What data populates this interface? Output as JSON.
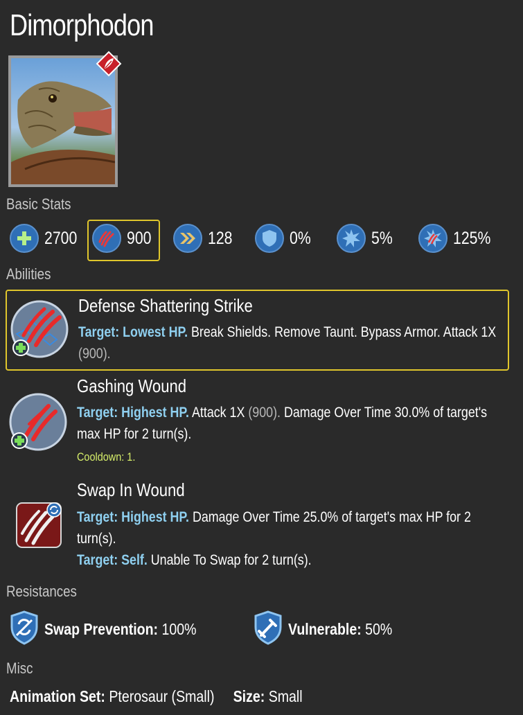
{
  "creature": {
    "name": "Dimorphodon",
    "rarity_icon": "rare-leaf-badge-icon",
    "portrait_icon": "dimorphodon-portrait"
  },
  "sections": {
    "basic_stats": "Basic Stats",
    "abilities": "Abilities",
    "resistances": "Resistances",
    "misc": "Misc"
  },
  "stats": [
    {
      "icon": "health-plus-icon",
      "value": "2700"
    },
    {
      "icon": "claw-damage-icon",
      "value": "900"
    },
    {
      "icon": "speed-chevron-icon",
      "value": "128"
    },
    {
      "icon": "armor-shield-icon",
      "value": "0%"
    },
    {
      "icon": "crit-chance-icon",
      "value": "5%"
    },
    {
      "icon": "crit-damage-icon",
      "value": "125%"
    }
  ],
  "abilities": [
    {
      "name": "Defense Shattering Strike",
      "icon": "shattering-claw-icon",
      "target_label": "Target: Lowest HP.",
      "effect": "Break Shields. Remove Taunt. Bypass Armor. Attack 1X",
      "damage": "(900).",
      "tail": ""
    },
    {
      "name": "Gashing Wound",
      "icon": "gashing-claw-icon",
      "target_label": "Target: Highest HP.",
      "effect": "Attack 1X",
      "damage": "(900).",
      "tail": "Damage Over Time 30.0% of target's max HP for 2 turn(s).",
      "cooldown": "Cooldown: 1."
    },
    {
      "name": "Swap In Wound",
      "icon": "swap-in-claw-icon",
      "target_label": "Target: Highest HP.",
      "effect": "Damage Over Time 25.0% of target's max HP for 2 turn(s).",
      "target_label_2": "Target: Self.",
      "effect_2": "Unable To Swap for 2 turn(s)."
    }
  ],
  "resistances": [
    {
      "icon": "swap-prevention-shield-icon",
      "label": "Swap Prevention:",
      "value": "100%"
    },
    {
      "icon": "vulnerable-shield-icon",
      "label": "Vulnerable:",
      "value": "50%"
    }
  ],
  "misc": {
    "animation_label": "Animation Set:",
    "animation_value": "Pterosaur (Small)",
    "size_label": "Size:",
    "size_value": "Small"
  },
  "colors": {
    "background": "#2a2a2a",
    "highlight": "#e0c62c",
    "target_text": "#8fd0f0",
    "cooldown_text": "#d6ee6a",
    "stat_icon_blue": "#2f6fb6"
  }
}
